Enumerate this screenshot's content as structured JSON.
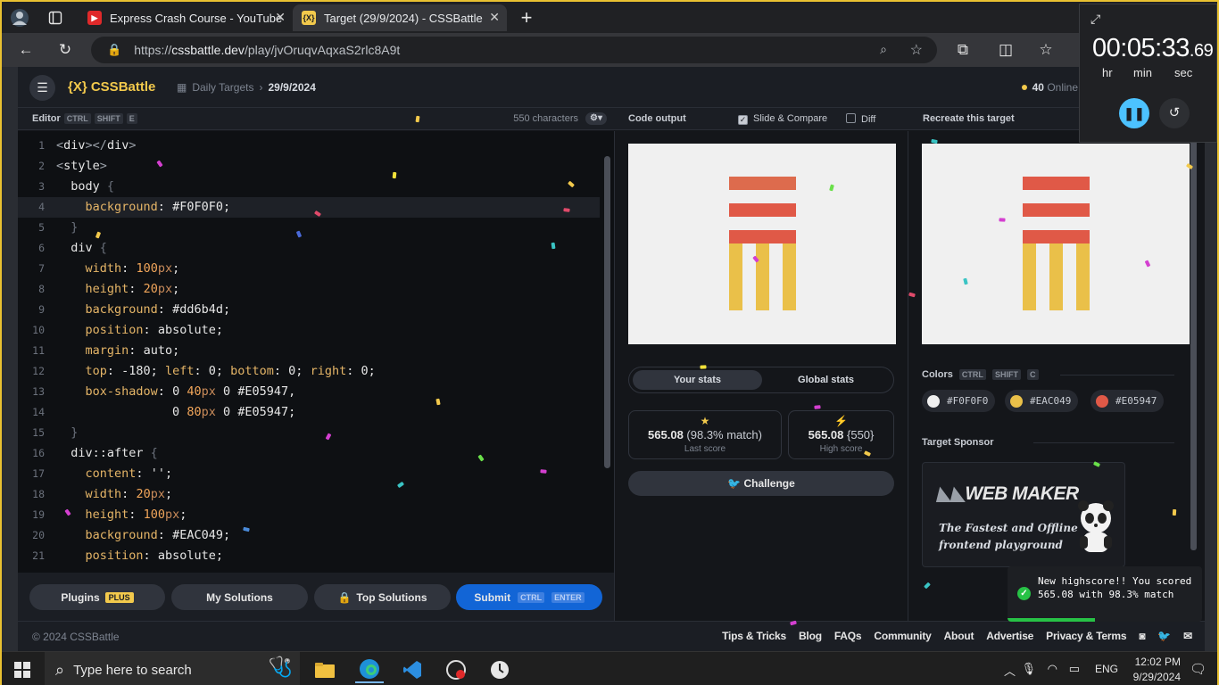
{
  "browser": {
    "tabs": [
      {
        "title": "Express Crash Course - YouTube",
        "active": false
      },
      {
        "title": "Target (29/9/2024) - CSSBattle",
        "active": true
      }
    ],
    "url_prefix": "https://",
    "url_host": "cssbattle.dev",
    "url_path": "/play/jvOruqvAqxaS2rlc8A9t"
  },
  "header": {
    "logo": "{X} CSSBattle",
    "breadcrumb_parent": "Daily Targets",
    "breadcrumb_current": "29/9/2024",
    "online_count": "40",
    "online_label": "Online"
  },
  "editor": {
    "title": "Editor",
    "shortcut": [
      "CTRL",
      "SHIFT",
      "E"
    ],
    "char_count": "550 characters",
    "lines": [
      {
        "n": "1",
        "text": "<div></div>"
      },
      {
        "n": "2",
        "text": "<style>"
      },
      {
        "n": "3",
        "text": "  body {"
      },
      {
        "n": "4",
        "text": "    background: #F0F0F0;"
      },
      {
        "n": "5",
        "text": "  }"
      },
      {
        "n": "6",
        "text": "  div {"
      },
      {
        "n": "7",
        "text": "    width: 100px;"
      },
      {
        "n": "8",
        "text": "    height: 20px;"
      },
      {
        "n": "9",
        "text": "    background: #dd6b4d;"
      },
      {
        "n": "10",
        "text": "    position: absolute;"
      },
      {
        "n": "11",
        "text": "    margin: auto;"
      },
      {
        "n": "12",
        "text": "    top: -180; left: 0; bottom: 0; right: 0;"
      },
      {
        "n": "13",
        "text": "    box-shadow: 0 40px 0 #E05947,"
      },
      {
        "n": "14",
        "text": "                0 80px 0 #E05947;"
      },
      {
        "n": "15",
        "text": "  }"
      },
      {
        "n": "16",
        "text": "  div::after {"
      },
      {
        "n": "17",
        "text": "    content: '';"
      },
      {
        "n": "18",
        "text": "    width: 20px;"
      },
      {
        "n": "19",
        "text": "    height: 100px;"
      },
      {
        "n": "20",
        "text": "    background: #EAC049;"
      },
      {
        "n": "21",
        "text": "    position: absolute;"
      }
    ],
    "highlighted_line": "4",
    "buttons": {
      "plugins": "Plugins",
      "plugins_tag": "PLUS",
      "my_solutions": "My Solutions",
      "top_solutions": "Top Solutions",
      "submit": "Submit",
      "submit_keys": [
        "CTRL",
        "ENTER"
      ]
    }
  },
  "output": {
    "title": "Code output",
    "slide_compare": "Slide & Compare",
    "slide_compare_checked": true,
    "diff": "Diff",
    "diff_checked": false,
    "tabs": [
      "Your stats",
      "Global stats"
    ],
    "selected_tab": "Your stats",
    "last_score": {
      "value": "565.08",
      "detail": "(98.3% match)",
      "label": "Last score"
    },
    "high_score": {
      "value": "565.08",
      "detail": "{550}",
      "label": "High score"
    },
    "challenge": "Challenge"
  },
  "target": {
    "title": "Recreate this target",
    "colors_title": "Colors",
    "colors_shortcut": [
      "CTRL",
      "SHIFT",
      "C"
    ],
    "colors": [
      {
        "hex": "#F0F0F0"
      },
      {
        "hex": "#EAC049"
      },
      {
        "hex": "#E05947"
      }
    ],
    "sponsor_title": "Target Sponsor",
    "sponsor_logo": "WEB MAKER",
    "sponsor_tagline": "The Fastest and Offline frontend playground"
  },
  "palette": {
    "background": "#F0F0F0",
    "stripe_top": "#dd6b4d",
    "stripe": "#E05947",
    "leg": "#EAC049"
  },
  "footer": {
    "copyright": "© 2024 CSSBattle",
    "links": [
      "Tips & Tricks",
      "Blog",
      "FAQs",
      "Community",
      "About",
      "Advertise",
      "Privacy & Terms"
    ]
  },
  "timer": {
    "time_main": "00:05:33",
    "time_frac": ".69",
    "units": [
      "hr",
      "min",
      "sec"
    ]
  },
  "toast": {
    "message": "New highscore!! You scored 565.08 with 98.3% match",
    "progress": 0.45
  },
  "taskbar": {
    "search_placeholder": "Type here to search",
    "lang": "ENG",
    "time": "12:02 PM",
    "date": "9/29/2024"
  }
}
